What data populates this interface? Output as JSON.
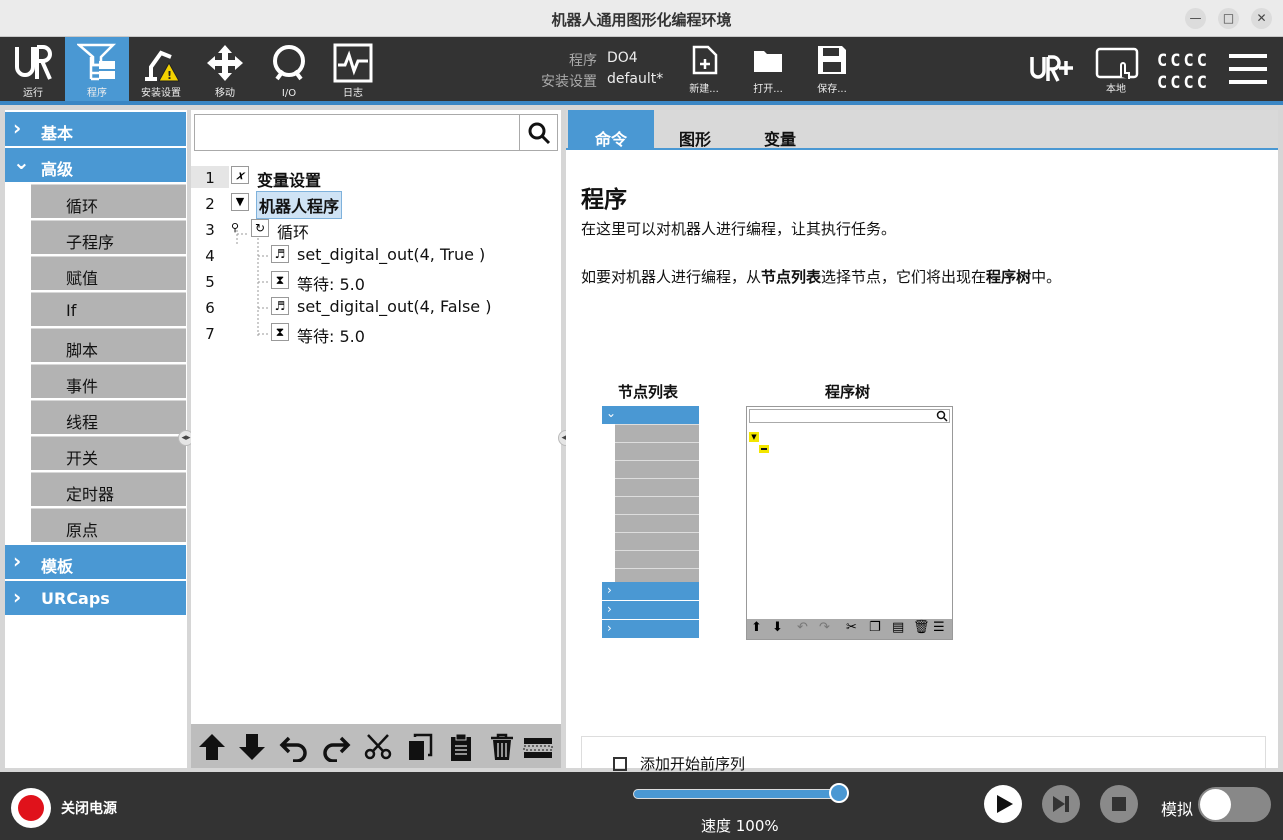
{
  "window": {
    "title": "机器人通用图形化编程环境"
  },
  "toolbar": {
    "tabs": [
      {
        "label": "运行"
      },
      {
        "label": "程序"
      },
      {
        "label": "安装设置"
      },
      {
        "label": "移动"
      },
      {
        "label": "I/O"
      },
      {
        "label": "日志"
      }
    ],
    "program_key": "程序",
    "program_value": "DO4",
    "install_key": "安装设置",
    "install_value": "default*",
    "new_label": "新建...",
    "open_label": "打开...",
    "save_label": "保存...",
    "local_label": "本地",
    "status_line1": "CCCC",
    "status_line2": "CCCC"
  },
  "leftnav": {
    "basic": "基本",
    "advanced": "高级",
    "items": [
      "循环",
      "子程序",
      "赋值",
      "If",
      "脚本",
      "事件",
      "线程",
      "开关",
      "定时器",
      "原点"
    ],
    "templates": "模板",
    "urcaps": "URCaps"
  },
  "tree": {
    "line_numbers": [
      "1",
      "2",
      "3",
      "4",
      "5",
      "6",
      "7"
    ],
    "nodes": [
      {
        "text": "变量设置"
      },
      {
        "text": "机器人程序"
      },
      {
        "text": "循环"
      },
      {
        "text": "set_digital_out(4, True )"
      },
      {
        "text": "等待: 5.0"
      },
      {
        "text": "set_digital_out(4, False )"
      },
      {
        "text": "等待: 5.0"
      }
    ]
  },
  "right": {
    "tabs": [
      "命令",
      "图形",
      "变量"
    ],
    "title": "程序",
    "desc1": "在这里可以对机器人进行编程，让其执行任务。",
    "desc2_a": "如要对机器人进行编程，从",
    "desc2_b": "节点列表",
    "desc2_c": "选择节点，它们将出现在",
    "desc2_d": "程序树",
    "desc2_e": "中。",
    "node_list_title": "节点列表",
    "program_tree_title": "程序树",
    "start_sequence_label": "添加开始前序列"
  },
  "bottom": {
    "power_label": "关闭电源",
    "speed_label": "速度 100%",
    "speed_value": 1.0,
    "sim_label": "模拟"
  },
  "colors": {
    "accent": "#4a98d3",
    "dark_bar": "#333333",
    "power_red": "#e0121b"
  }
}
